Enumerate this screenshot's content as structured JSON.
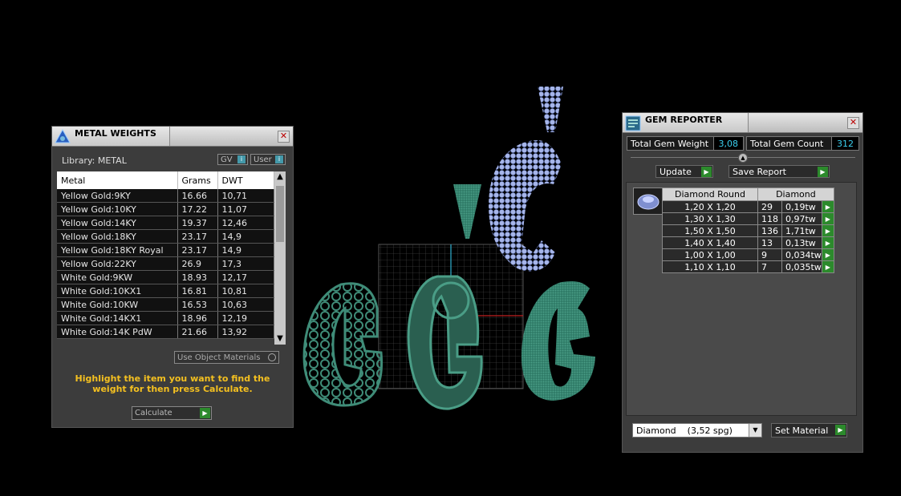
{
  "metal_weights": {
    "title": "METAL WEIGHTS",
    "library_label": "Library: METAL",
    "toggle_gv": "GV",
    "toggle_user": "User",
    "columns": [
      "Metal",
      "Grams",
      "DWT"
    ],
    "rows": [
      [
        "Yellow Gold:9KY",
        "16.66",
        "10,71"
      ],
      [
        "Yellow Gold:10KY",
        "17.22",
        "11,07"
      ],
      [
        "Yellow Gold:14KY",
        "19.37",
        "12,46"
      ],
      [
        "Yellow Gold:18KY",
        "23.17",
        "14,9"
      ],
      [
        "Yellow Gold:18KY Royal",
        "23.17",
        "14,9"
      ],
      [
        "Yellow Gold:22KY",
        "26.9",
        "17,3"
      ],
      [
        "White Gold:9KW",
        "18.93",
        "12,17"
      ],
      [
        "White Gold:10KX1",
        "16.81",
        "10,81"
      ],
      [
        "White Gold:10KW",
        "16.53",
        "10,63"
      ],
      [
        "White Gold:14KX1",
        "18.96",
        "12,19"
      ],
      [
        "White Gold:14K PdW",
        "21.66",
        "13,92"
      ]
    ],
    "use_object_materials": "Use Object Materials",
    "hint": "Highlight the item you want to find the weight for then press Calculate.",
    "calculate_label": "Calculate"
  },
  "gem_reporter": {
    "title": "GEM REPORTER",
    "total_weight_label": "Total Gem Weight",
    "total_weight_value": "3,08",
    "total_count_label": "Total Gem Count",
    "total_count_value": "312",
    "update_label": "Update",
    "save_report_label": "Save Report",
    "table_headers": [
      "Diamond Round",
      "Diamond"
    ],
    "rows": [
      [
        "1,20 X 1,20",
        "29",
        "0,19tw"
      ],
      [
        "1,30 X 1,30",
        "118",
        "0,97tw"
      ],
      [
        "1,50 X 1,50",
        "136",
        "1,71tw"
      ],
      [
        "1,40 X 1,40",
        "13",
        "0,13tw"
      ],
      [
        "1,00 X 1,00",
        "9",
        "0,034tw"
      ],
      [
        "1,10 X 1,10",
        "7",
        "0,035tw"
      ]
    ],
    "material_select": "Diamond    (3,52 spg)",
    "set_material_label": "Set Material"
  },
  "colors": {
    "metal_green": "#3f8c78",
    "gem_blue": "#8ea3e0",
    "accent_cyan": "#3cd0f0",
    "hint_yellow": "#f4c020",
    "button_green": "#2c8a2c"
  }
}
